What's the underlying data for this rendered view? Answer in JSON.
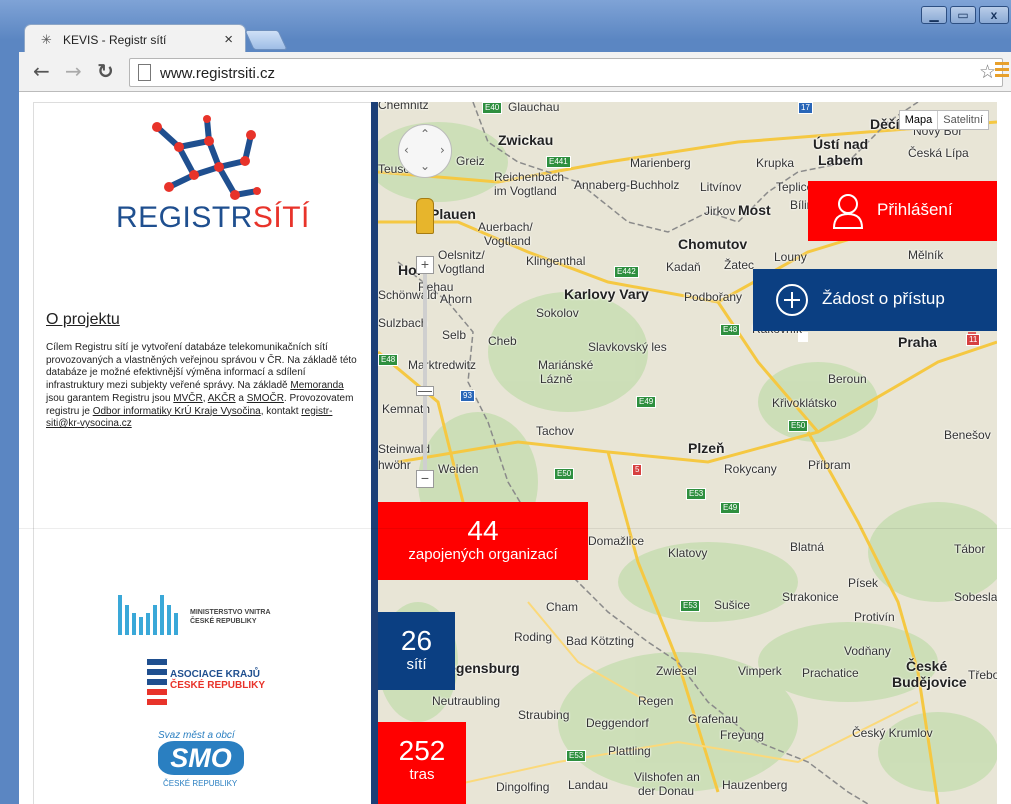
{
  "window": {
    "controls": [
      "▁",
      "▭",
      "x"
    ]
  },
  "tab": {
    "icon": "network-icon",
    "title": "KEVIS - Registr sítí",
    "close": "×"
  },
  "toolbar": {
    "url": "www.registrsiti.cz",
    "back": "←",
    "forward": "→",
    "reload": "↻",
    "star": "☆"
  },
  "brand": {
    "prefix": "REGISTR",
    "suffix": "SÍTÍ"
  },
  "about": {
    "title": "O projektu",
    "paragraph_parts": [
      "Cílem Registru sítí je vytvoření databáze telekomunikačních sítí provozovaných a vlastněných veřejnou správou v ČR. Na základě této databáze je možné efektivnější výměna informací a sdílení infrastruktury mezi subjekty veřené správy. Na základě ",
      "Memoranda",
      " jsou garantem Registru jsou ",
      "MVČR",
      ", ",
      "AKČR",
      " a ",
      "SMOČR",
      ". Provozovatem registru je ",
      "Odbor informatiky KrÚ Kraje Vysočina",
      ", kontakt ",
      "registr-siti@kr-vysocina.cz"
    ]
  },
  "partners": {
    "mvcr": "MINISTERSTVO VNITRA\nČESKÉ REPUBLIKY",
    "akcr_line1": "ASOCIACE KRAJŮ",
    "akcr_line2": "ČESKÉ REPUBLIKY",
    "smo_top": "Svaz měst a obcí",
    "smo_main": "SMO",
    "smo_sub": "ČESKÉ REPUBLIKY"
  },
  "map": {
    "type_buttons": [
      "Mapa",
      "Satelitní"
    ],
    "zoom_in": "+",
    "zoom_out": "−",
    "labels": [
      "Chemnitz",
      "Glauchau",
      "Zwickau",
      "Děčín",
      "Nový Bor",
      "Ústí nad",
      "Labem",
      "Česká Lípa",
      "Greiz",
      "Marienberg",
      "Krupka",
      "Reichenbach",
      "im Vogtland",
      "Annaberg-Buchholz",
      "Litvínov",
      "Teplice",
      "Plauen",
      "Jirkov",
      "Most",
      "Bílina",
      "Auerbach/",
      "Vogtland",
      "Chomutov",
      "Oelsnitz/",
      "Vogtland",
      "Klingenthal",
      "Kadaň",
      "Žatec",
      "Louny",
      "Mělník",
      "Hof",
      "Rehau",
      "Karlovy Vary",
      "Podbořany",
      "Sokolov",
      "Rakovník",
      "Selb",
      "Cheb",
      "Slavkovský les",
      "Praha",
      "Marktredwitz",
      "Mariánské",
      "Lázně",
      "Beroun",
      "Kemnath",
      "Křivoklátsko",
      "Tachov",
      "Benešov",
      "Plzeň",
      "Rokycany",
      "Příbram",
      "Weiden",
      "Domažlice",
      "Klatovy",
      "Blatná",
      "Tábor",
      "Písek",
      "Strakonice",
      "Sobesla",
      "Cham",
      "Sušice",
      "Protivín",
      "Roding",
      "Bad Kötzting",
      "Vodňany",
      "Zwiesel",
      "Vimperk",
      "Prachatice",
      "České",
      "Budějovice",
      "Třebo",
      "Neutraubling",
      "Regen",
      "Straubing",
      "Deggendorf",
      "Grafenau",
      "Freyung",
      "Český Krumlov",
      "Plattling",
      "Dingolfing",
      "Landau",
      "Vilshofen an",
      "der Donau",
      "Hauzenberg",
      "Sulzbach",
      "Ahorn",
      "Schönwald",
      "Steinwald",
      "Teuschnitz",
      "Regensburg",
      "hwöhr"
    ],
    "road_shields": [
      "E40",
      "E441",
      "E442",
      "E48",
      "E48",
      "E49",
      "93",
      "E50",
      "5",
      "E53",
      "E49",
      "E50",
      "E53",
      "E53",
      "11",
      "17"
    ]
  },
  "actions": {
    "login": "Přihlášení",
    "request": "Žádost o přístup"
  },
  "stats": [
    {
      "value": "44",
      "label": "zapojených organizací"
    },
    {
      "value": "26",
      "label": "sítí"
    },
    {
      "value": "252",
      "label": "tras"
    }
  ],
  "colors": {
    "red": "#ff0000",
    "navy": "#0b3f82",
    "brand_blue": "#1f4f8f",
    "brand_red": "#e8332a"
  }
}
